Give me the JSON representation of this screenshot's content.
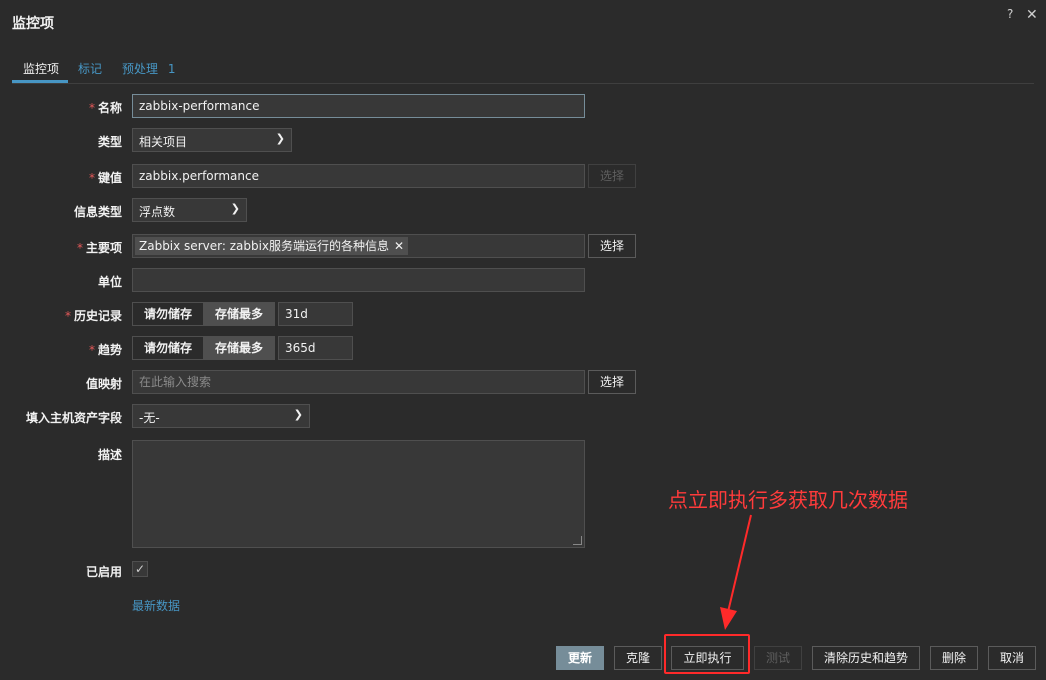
{
  "dialog": {
    "title": "监控项",
    "help_icon": "?",
    "close_icon": "✕"
  },
  "tabs": [
    {
      "label": "监控项"
    },
    {
      "label": "标记"
    },
    {
      "label": "预处理",
      "count": "1"
    }
  ],
  "form": {
    "name": {
      "label": "名称",
      "value": "zabbix-performance"
    },
    "type": {
      "label": "类型",
      "value": "相关项目"
    },
    "key": {
      "label": "键值",
      "value": "zabbix.performance",
      "button": "选择"
    },
    "info_type": {
      "label": "信息类型",
      "value": "浮点数"
    },
    "master_item": {
      "label": "主要项",
      "tag": "Zabbix server: zabbix服务端运行的各种信息",
      "button": "选择"
    },
    "units": {
      "label": "单位",
      "value": ""
    },
    "history": {
      "label": "历史记录",
      "opt_off": "请勿储存",
      "opt_on": "存储最多",
      "value": "31d"
    },
    "trends": {
      "label": "趋势",
      "opt_off": "请勿储存",
      "opt_on": "存储最多",
      "value": "365d"
    },
    "value_map": {
      "label": "值映射",
      "placeholder": "在此输入搜索",
      "button": "选择"
    },
    "inventory": {
      "label": "填入主机资产字段",
      "value": "-无-"
    },
    "description": {
      "label": "描述"
    },
    "enabled": {
      "label": "已启用",
      "checked": true
    },
    "latest_data_link": "最新数据"
  },
  "annotation": {
    "text": "点立即执行多获取几次数据",
    "color": "#ff3b3b"
  },
  "footer": {
    "update": "更新",
    "clone": "克隆",
    "execute_now": "立即执行",
    "test": "测试",
    "clear_history": "清除历史和趋势",
    "delete": "删除",
    "cancel": "取消"
  },
  "colors": {
    "accent": "#4796c4",
    "primary_button": "#768d99",
    "background": "#2b2b2b",
    "required": "#e45959"
  }
}
